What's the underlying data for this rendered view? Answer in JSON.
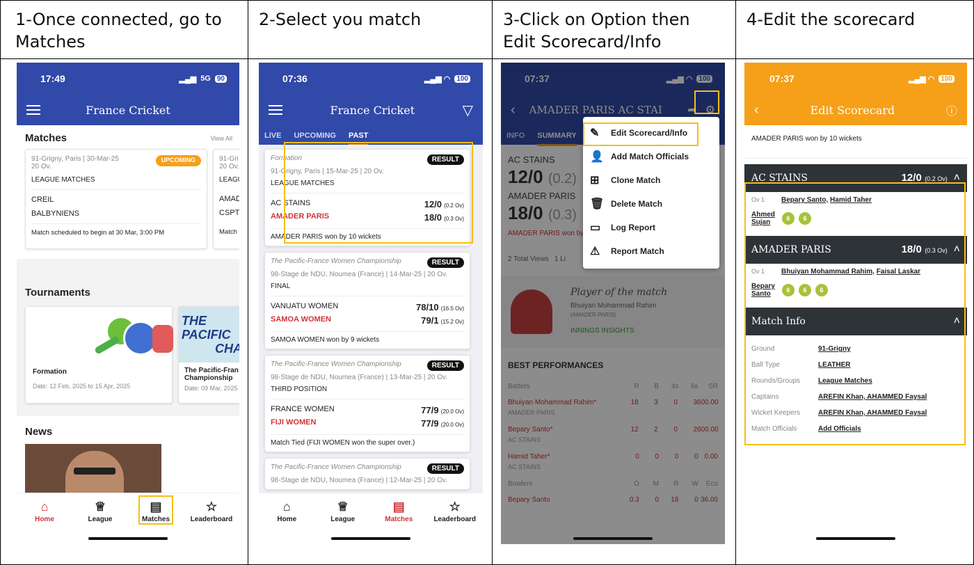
{
  "headers": {
    "col1": "1-Once connected, go to Matches",
    "col2": "2-Select you match",
    "col3": "3-Click on Option then Edit Scorecard/Info",
    "col4": "4-Edit the scorecard"
  },
  "p1": {
    "time": "17:49",
    "net": "5G",
    "battery": "90",
    "title": "France Cricket",
    "matches_heading": "Matches",
    "view_all": "View All",
    "card": {
      "venue": "91-Grigny, Paris",
      "date": "30-Mar-25",
      "overs": "20 Ov.",
      "badge": "UPCOMING",
      "league": "LEAGUE MATCHES",
      "team1": "CREIL",
      "team2": "BALBYNIENS",
      "note": "Match scheduled to begin at 30 Mar, 3:00 PM"
    },
    "card2": {
      "venue": "91-Gri",
      "overs": "20 Ov.",
      "league": "LEAGU",
      "team1": "AMAD",
      "team2": "CSPT",
      "note": "Match"
    },
    "tournaments_heading": "Tournaments",
    "t1": {
      "name": "Formation",
      "date": "Date: 12 Feb, 2025 to 15 Apr, 2025"
    },
    "t2": {
      "banner": "THE PACIFIC",
      "banner2": "CHA",
      "name": "The Pacific-Fran Championship",
      "date": "Date: 09 Mar, 2025 t"
    },
    "news_heading": "News",
    "nav": [
      "Home",
      "League",
      "Matches",
      "Leaderboard"
    ]
  },
  "p2": {
    "time": "07:36",
    "battery": "100",
    "title": "France Cricket",
    "tabs": [
      "LIVE",
      "UPCOMING",
      "PAST"
    ],
    "result": "RESULT",
    "matches": [
      {
        "tour": "Formation",
        "venue": "91-Grigny, Paris",
        "date": "15-Mar-25",
        "overs": "20 Ov.",
        "stage": "LEAGUE MATCHES",
        "t1": "AC STAINS",
        "s1": "12/0",
        "o1": "(0.2 Ov)",
        "t2": "AMADER PARIS",
        "s2": "18/0",
        "o2": "(0.3 Ov)",
        "result": "AMADER PARIS won by 10 wickets"
      },
      {
        "tour": "The Pacific-France Women Championship",
        "venue": "98-Stage de NDU, Noumea (France)",
        "date": "14-Mar-25",
        "overs": "20 Ov.",
        "stage": "FINAL",
        "t1": "VANUATU WOMEN",
        "s1": "78/10",
        "o1": "(16.5 Ov)",
        "t2": "SAMOA WOMEN",
        "s2": "79/1",
        "o2": "(15.2 Ov)",
        "result": "SAMOA WOMEN won by 9 wickets"
      },
      {
        "tour": "The Pacific-France Women Championship",
        "venue": "98-Stage de NDU, Noumea (France)",
        "date": "13-Mar-25",
        "overs": "20 Ov.",
        "stage": "THIRD POSITION",
        "t1": "FRANCE WOMEN",
        "s1": "77/9",
        "o1": "(20.0 Ov)",
        "t2": "FIJI WOMEN",
        "s2": "77/9",
        "o2": "(20.0 Ov)",
        "result": "Match Tied (FIJI WOMEN won the super over.)"
      },
      {
        "tour": "The Pacific-France Women Championship",
        "venue": "98-Stage de NDU, Noumea (France)",
        "date": "12-Mar-25",
        "overs": "20 Ov."
      }
    ],
    "nav": [
      "Home",
      "League",
      "Matches",
      "Leaderboard"
    ]
  },
  "p3": {
    "time": "07:37",
    "battery": "100",
    "title": "AMADER PARIS  AC STAI",
    "tabs": [
      "INFO",
      "SUMMARY"
    ],
    "team1": "AC STAINS",
    "score1": "12/0",
    "ov1": "(0.2)",
    "team2": "AMADER PARIS",
    "score2": "18/0",
    "ov2": "(0.3)",
    "won": "AMADER PARIS won by",
    "views": "2 Total Views",
    "live": "1 Li",
    "potm": "Player of the match",
    "potm_name": "Bhuiyan Mohammad Rahim",
    "potm_team": "(AMADER PARIS)",
    "insights": "INNINGS INSIGHTS",
    "best": "BEST PERFORMANCES",
    "bat_head": [
      "Batters",
      "R",
      "B",
      "4s",
      "6s",
      "SR"
    ],
    "batters": [
      {
        "name": "Bhuiyan Mohammad Rahim*",
        "team": "AMADER PARIS",
        "r": "18",
        "b": "3",
        "f": "0",
        "s": "3",
        "sr": "600.00"
      },
      {
        "name": "Bepary Santo*",
        "team": "AC STAINS",
        "r": "12",
        "b": "2",
        "f": "0",
        "s": "2",
        "sr": "600.00"
      },
      {
        "name": "Hamid Taher*",
        "team": "AC STAINS",
        "r": "0",
        "b": "0",
        "f": "0",
        "s": "0",
        "sr": "0.00"
      }
    ],
    "bowl_head": [
      "Bowlers",
      "O",
      "M",
      "R",
      "W",
      "Eco"
    ],
    "bowler": {
      "name": "Bepary Santo",
      "o": "0.3",
      "m": "0",
      "r": "18",
      "w": "0",
      "eco": "36.00"
    },
    "menu": [
      "Edit Scorecard/Info",
      "Add Match Officials",
      "Clone Match",
      "Delete Match",
      "Log Report",
      "Report Match"
    ]
  },
  "p4": {
    "time": "07:37",
    "battery": "100",
    "title": "Edit Scorecard",
    "won": "AMADER PARIS won by 10 wickets",
    "inn1": {
      "team": "AC STAINS",
      "score": "12/0",
      "ov": "(0.2 Ov)",
      "over": "Ov 1",
      "bat1": "Bepary Santo,",
      "bat2": "Hamid Taher",
      "bowler": "Ahmed Sujan",
      "balls": [
        "6",
        "6"
      ]
    },
    "inn2": {
      "team": "AMADER PARIS",
      "score": "18/0",
      "ov": "(0.3 Ov)",
      "over": "Ov 1",
      "bat1": "Bhuiyan Mohammad Rahim,",
      "bat2": "Faisal Laskar",
      "bowler": "Bepary Santo",
      "balls": [
        "6",
        "6",
        "6"
      ]
    },
    "info_heading": "Match Info",
    "info": [
      {
        "k": "Ground",
        "v": "91-Grigny"
      },
      {
        "k": "Ball Type",
        "v": "LEATHER"
      },
      {
        "k": "Rounds/Groups",
        "v": "League Matches"
      },
      {
        "k": "Captains",
        "v": "AREFIN Khan, AHAMMED Faysal"
      },
      {
        "k": "Wicket Keepers",
        "v": "AREFIN Khan, AHAMMED Faysal"
      },
      {
        "k": "Match Officials",
        "v": "Add Officials"
      }
    ]
  }
}
